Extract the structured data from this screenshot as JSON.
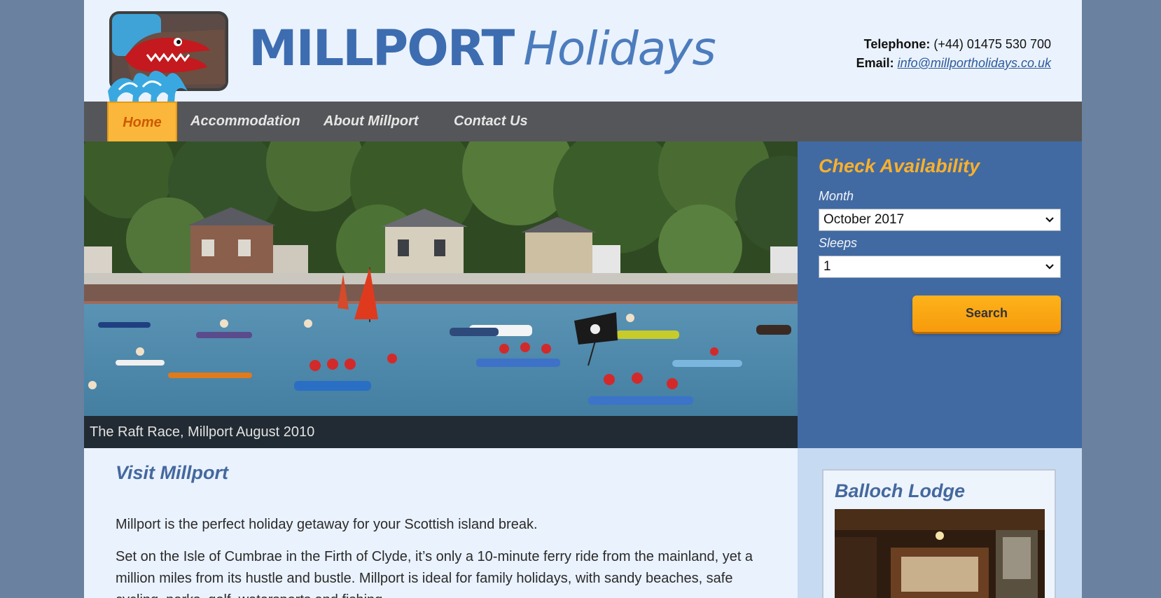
{
  "brand": {
    "name_bold": "MILLPORT",
    "name_light": "Holidays",
    "logo_icon": "crocodile-rock-icon"
  },
  "contact": {
    "phone_label": "Telephone:",
    "phone_value": "(+44) 01475 530 700",
    "email_label": "Email:",
    "email_value": "info@millportholidays.co.uk"
  },
  "nav": {
    "items": [
      "Home",
      "Accommodation",
      "About Millport",
      "Contact Us"
    ],
    "active": "Home"
  },
  "hero": {
    "caption": "The Raft Race, Millport August 2010"
  },
  "availability": {
    "title": "Check Availability",
    "month_label": "Month",
    "month_value": "October 2017",
    "sleeps_label": "Sleeps",
    "sleeps_value": "1",
    "search_label": "Search"
  },
  "content": {
    "heading": "Visit Millport",
    "para1": "Millport is the perfect holiday getaway for your Scottish island break.",
    "para2": "Set on the Isle of Cumbrae in the Firth of Clyde, it’s only a 10-minute ferry ride from the mainland, yet a million miles from its hustle and bustle. Millport is ideal for family holidays, with sandy beaches, safe cycling, parks, golf, watersports and fishing."
  },
  "sidebar": {
    "lodge_title": "Balloch Lodge"
  },
  "colors": {
    "page_bg": "#6a819f",
    "content_bg": "#eaf2fd",
    "brand_blue": "#3d6db0",
    "nav_bg": "#555659",
    "nav_active_bg": "#fbb73b",
    "nav_active_text": "#cc5a00",
    "avail_bg": "#416aa3",
    "avail_title": "#fbb02b",
    "button": "#f9a514",
    "heading": "#44689e"
  }
}
